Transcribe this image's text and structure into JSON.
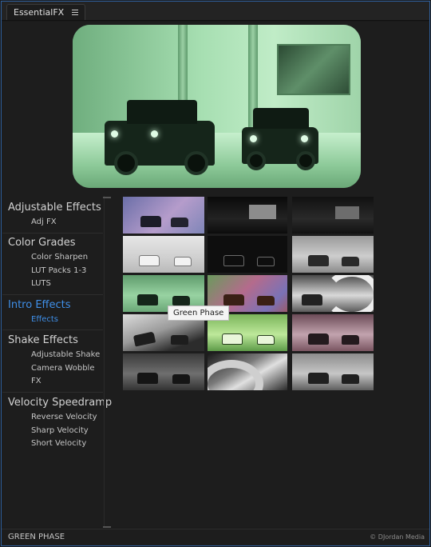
{
  "app": {
    "tab_title": "EssentialFX"
  },
  "sidebar": {
    "sections": [
      {
        "title": "Adjustable Effects",
        "items": [
          "Adj FX"
        ]
      },
      {
        "title": "Color Grades",
        "items": [
          "Color Sharpen",
          "LUT Packs 1-3",
          "LUTS"
        ]
      },
      {
        "title": "Intro Effects",
        "items": [
          "Effects"
        ]
      },
      {
        "title": "Shake Effects",
        "items": [
          "Adjustable Shake",
          "Camera Wobble",
          "FX"
        ]
      },
      {
        "title": "Velocity Speedramp",
        "items": [
          "Reverse Velocity",
          "Sharp Velocity",
          "Short Velocity"
        ]
      }
    ]
  },
  "tooltip": "Green Phase",
  "status": {
    "selected": "GREEN PHASE",
    "copyright": "© DJordan Media"
  },
  "colors": {
    "accent": "#3f8fe8",
    "frame_border": "#2f5f9c"
  }
}
